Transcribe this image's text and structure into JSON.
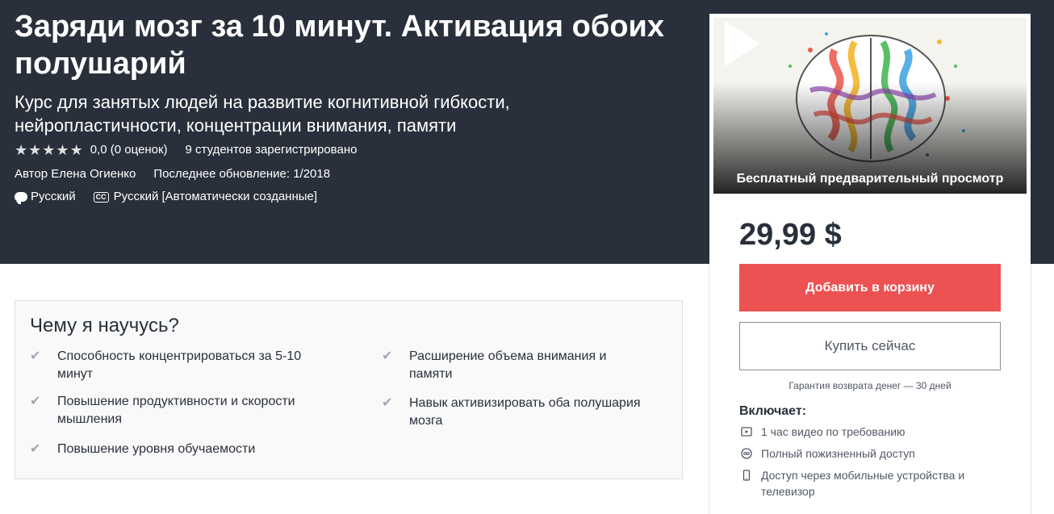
{
  "course": {
    "title": "Заряди мозг за 10 минут. Активация обоих полушарий",
    "subtitle": "Курс для занятых людей на развитие когнитивной гибкости, нейропластичности, концентрации внимания, памяти",
    "rating_stars": 0,
    "rating_text": "0,0 (0 оценок)",
    "students_text": "9 студентов зарегистрировано",
    "author_text": "Автор Елена Огиенко",
    "updated_text": "Последнее обновление: 1/2018",
    "language": "Русский",
    "captions": "Русский [Автоматически созданные]",
    "cc_label": "CC"
  },
  "learn": {
    "title": "Чему я научусь?",
    "items": [
      "Способность концентрироваться за 5-10 минут",
      "Расширение объема внимания и памяти",
      "Повышение продуктивности и скорости мышления",
      "Навык активизировать оба полушария мозга",
      "Повышение уровня обучаемости"
    ]
  },
  "sidebar": {
    "preview_label": "Бесплатный предварительный просмотр",
    "price": "29,99 $",
    "add_to_cart": "Добавить в корзину",
    "buy_now": "Купить сейчас",
    "guarantee": "Гарантия возврата денег — 30 дней",
    "includes_title": "Включает:",
    "includes": [
      {
        "icon": "video-icon",
        "text": "1 час видео по требованию"
      },
      {
        "icon": "infinity-icon",
        "text": "Полный пожизненный доступ"
      },
      {
        "icon": "mobile-icon",
        "text": "Доступ через мобильные устройства и телевизор"
      }
    ]
  },
  "colors": {
    "hero_bg": "#29303b",
    "cart_button": "#ec5252",
    "star_empty": "#dedfe0",
    "check": "#a1a7b3"
  }
}
